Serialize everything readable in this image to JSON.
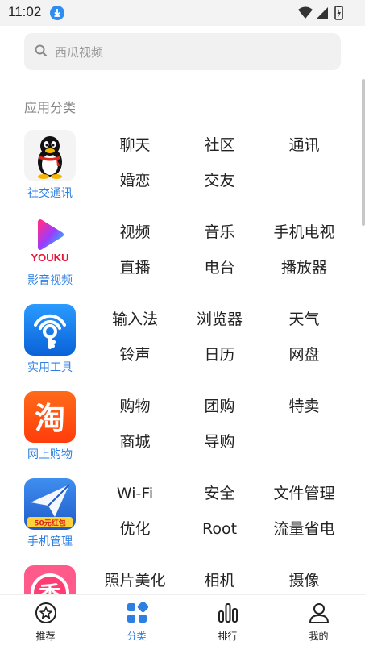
{
  "status_bar": {
    "time": "11:02"
  },
  "search": {
    "placeholder": "西瓜视频"
  },
  "section_title": "应用分类",
  "categories": [
    {
      "name": "社交通讯",
      "icon": "qq-penguin-icon",
      "tags": [
        "聊天",
        "社区",
        "通讯",
        "婚恋",
        "交友"
      ]
    },
    {
      "name": "影音视频",
      "icon": "youku-icon",
      "icon_text": "YOUKU",
      "tags": [
        "视频",
        "音乐",
        "手机电视",
        "直播",
        "电台",
        "播放器"
      ]
    },
    {
      "name": "实用工具",
      "icon": "wifi-key-icon",
      "tags": [
        "输入法",
        "浏览器",
        "天气",
        "铃声",
        "日历",
        "网盘"
      ]
    },
    {
      "name": "网上购物",
      "icon": "taobao-icon",
      "icon_text": "淘",
      "tags": [
        "购物",
        "团购",
        "特卖",
        "商城",
        "导购"
      ]
    },
    {
      "name": "手机管理",
      "icon": "paper-plane-icon",
      "icon_text": "50元红包",
      "tags": [
        "Wi-Fi",
        "安全",
        "文件管理",
        "优化",
        "Root",
        "流量省电"
      ]
    },
    {
      "name": "",
      "icon": "meitu-xiu-icon",
      "icon_text": "秀",
      "tags": [
        "照片美化",
        "相机",
        "摄像"
      ]
    }
  ],
  "tabbar": [
    {
      "label": "推荐",
      "icon": "star-badge-icon",
      "active": false
    },
    {
      "label": "分类",
      "icon": "category-grid-icon",
      "active": true
    },
    {
      "label": "排行",
      "icon": "bar-chart-icon",
      "active": false
    },
    {
      "label": "我的",
      "icon": "person-icon",
      "active": false
    }
  ],
  "colors": {
    "accent": "#2d7fe3",
    "text": "#222222",
    "muted": "#888888"
  }
}
